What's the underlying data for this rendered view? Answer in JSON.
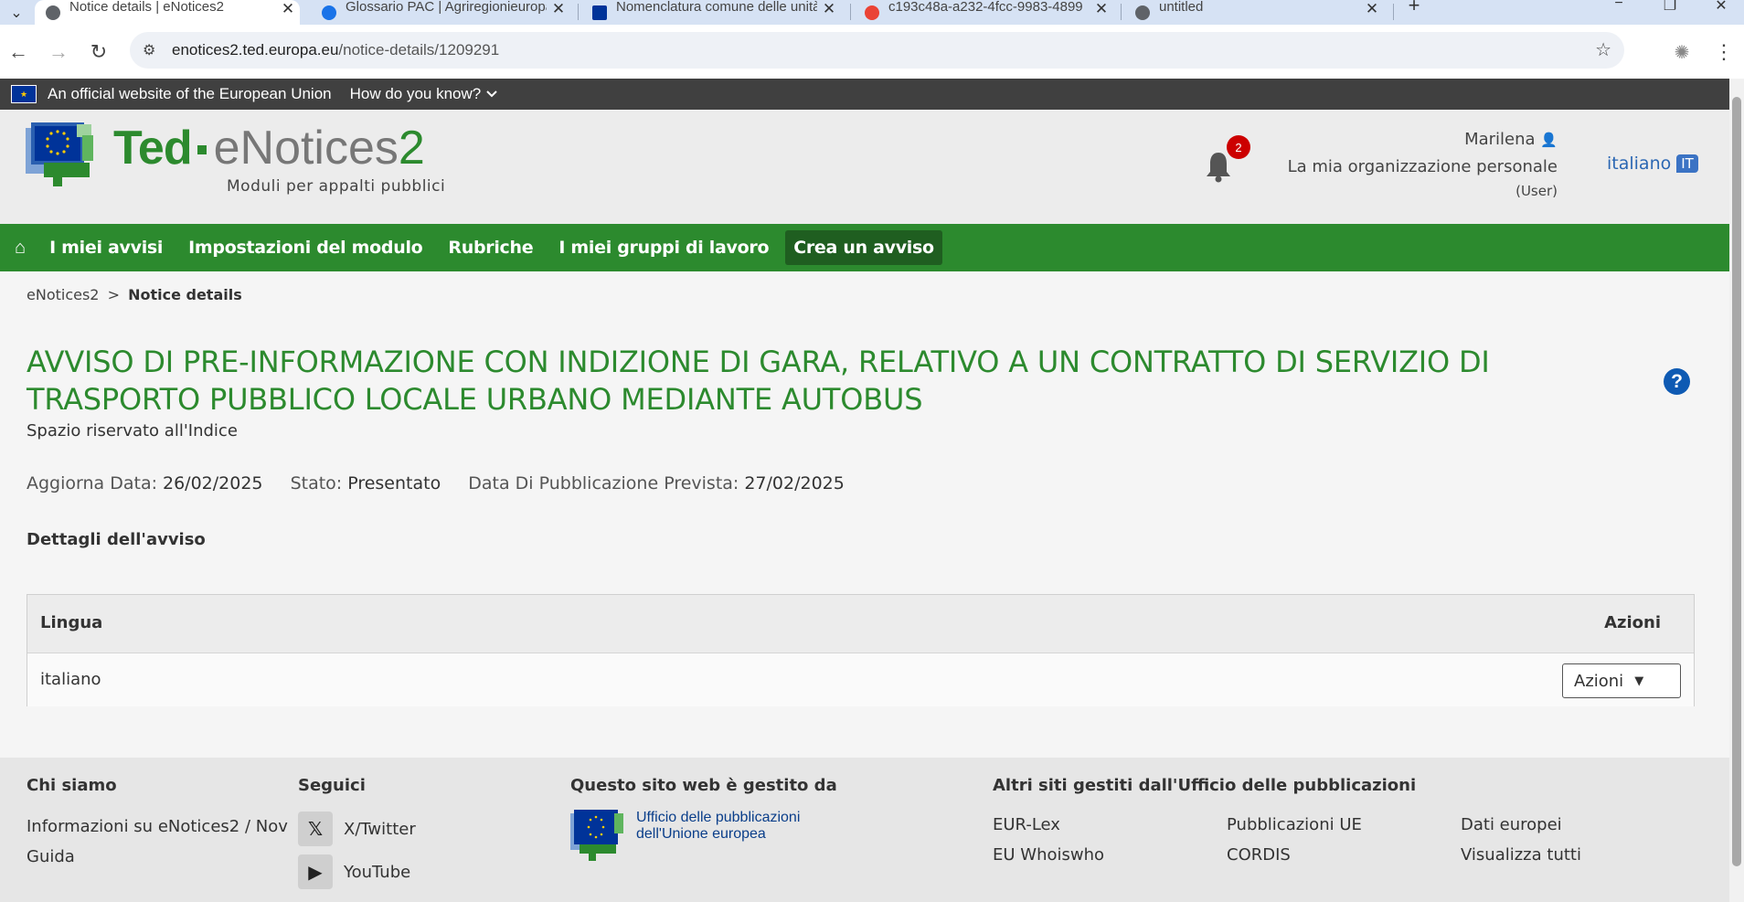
{
  "browser": {
    "tabs": [
      {
        "title": "Notice details | eNotices2",
        "active": true
      },
      {
        "title": "Glossario PAC | Agriregionieuropa"
      },
      {
        "title": "Nomenclatura comune delle unità"
      },
      {
        "title": "c193c48a-a232-4fcc-9983-4899"
      },
      {
        "title": "untitled"
      }
    ],
    "new_tab": "+",
    "close_glyph": "✕",
    "url_host": "enotices2.ted.europa.eu",
    "url_path": "/notice-details/1209291"
  },
  "eu_bar": {
    "official": "An official website of the European Union",
    "how": "How do you know?"
  },
  "header": {
    "brand_ted": "Ted",
    "brand_enotices": "eNotices",
    "brand_two": "2",
    "subtitle": "Moduli per appalti pubblici",
    "notifications_count": "2",
    "user_name": "Marilena",
    "user_org": "La mia organizzazione personale",
    "user_role": "(User)",
    "language": "italiano",
    "language_code": "IT"
  },
  "menu": {
    "items": [
      "I miei avvisi",
      "Impostazioni del modulo",
      "Rubriche",
      "I miei gruppi di lavoro"
    ],
    "create": "Crea un avviso"
  },
  "breadcrumb": {
    "root": "eNotices2",
    "sep": ">",
    "current": "Notice details"
  },
  "notice": {
    "title": "AVVISO DI PRE-INFORMAZIONE CON INDIZIONE DI GARA, RELATIVO A UN CONTRATTO DI SERVIZIO DI TRASPORTO PUBBLICO LOCALE URBANO MEDIANTE AUTOBUS",
    "reserved": "Spazio riservato all'Indice",
    "update_label": "Aggiorna Data:",
    "update_value": "26/02/2025",
    "status_label": "Stato:",
    "status_value": "Presentato",
    "pub_label": "Data Di Pubblicazione Prevista:",
    "pub_value": "27/02/2025",
    "details_heading": "Dettagli dell'avviso"
  },
  "table": {
    "col_lang": "Lingua",
    "col_actions": "Azioni",
    "rows": [
      {
        "lang": "italiano",
        "action": "Azioni"
      }
    ]
  },
  "footer": {
    "about_h": "Chi siamo",
    "about_link1": "Informazioni su eNotices2 / Nov",
    "about_link2": "Guida",
    "follow_h": "Seguici",
    "twitter": "X/Twitter",
    "youtube": "YouTube",
    "managed_h": "Questo sito web è gestito da",
    "op_line1": "Ufficio delle pubblicazioni",
    "op_line2": "dell'Unione europea",
    "other_h": "Altri siti gestiti dall'Ufficio delle pubblicazioni",
    "other_links": [
      "EUR-Lex",
      "Pubblicazioni UE",
      "Dati europei",
      "EU Whoiswho",
      "CORDIS",
      "Visualizza tutti"
    ]
  },
  "colors": {
    "brand_green": "#2c8a2e",
    "eu_blue": "#003399",
    "badge_red": "#cc0000",
    "link_blue": "#2b67b3"
  }
}
